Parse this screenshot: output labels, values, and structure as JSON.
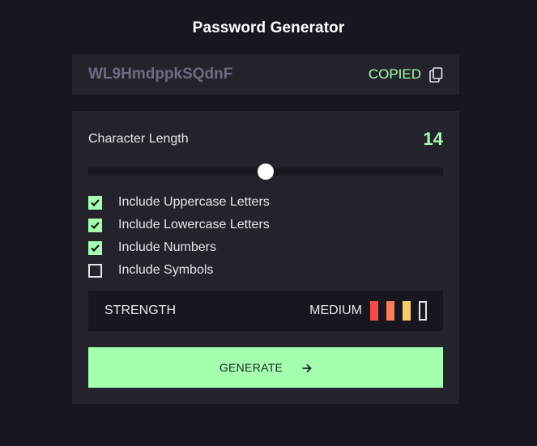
{
  "app": {
    "title": "Password Generator"
  },
  "password": {
    "value": "WL9HmdppkSQdnF",
    "copied_label": "COPIED",
    "copy_icon": "copy-icon"
  },
  "length": {
    "label": "Character Length",
    "value": "14",
    "slider_fraction": 0.5
  },
  "options": [
    {
      "label": "Include Uppercase Letters",
      "checked": true
    },
    {
      "label": "Include Lowercase Letters",
      "checked": true
    },
    {
      "label": "Include Numbers",
      "checked": true
    },
    {
      "label": "Include Symbols",
      "checked": false
    }
  ],
  "strength": {
    "label": "STRENGTH",
    "level": "MEDIUM",
    "bars": [
      {
        "filled": true,
        "color": "#f64a4a"
      },
      {
        "filled": true,
        "color": "#fb7c58"
      },
      {
        "filled": true,
        "color": "#f8cd65"
      },
      {
        "filled": false,
        "color": "#e6e5ea"
      }
    ]
  },
  "generate": {
    "label": "GENERATE",
    "icon": "arrow-right-icon"
  },
  "colors": {
    "accent": "#a4ffaf",
    "panel": "#24232c",
    "background": "#18171f",
    "muted_text": "#6e6b82"
  }
}
